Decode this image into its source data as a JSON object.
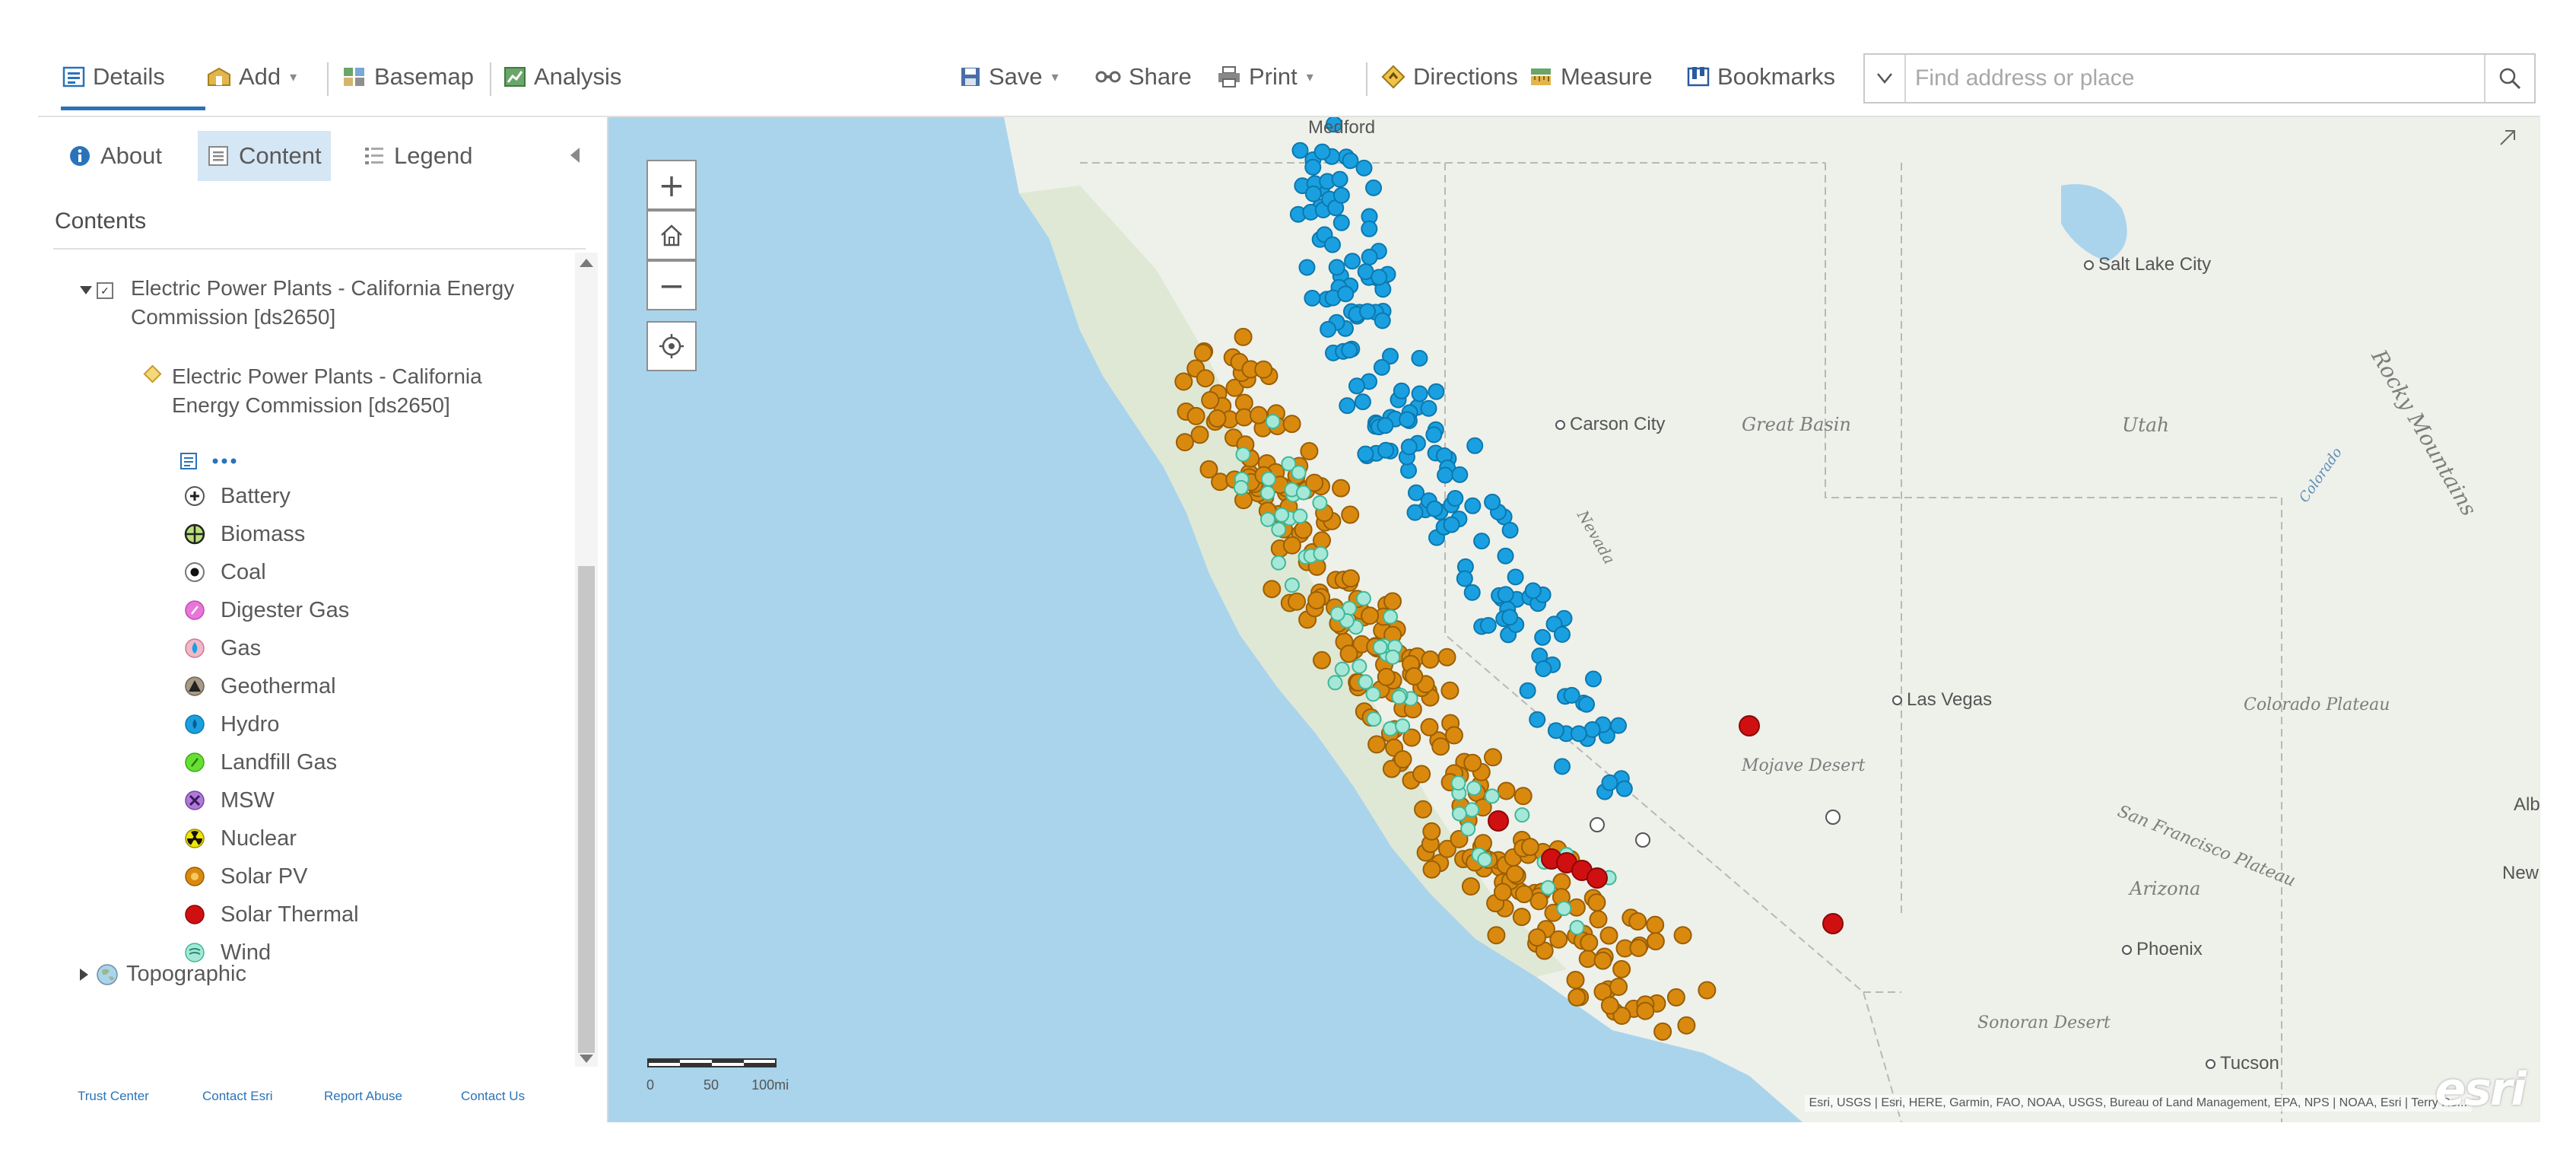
{
  "toolbar": {
    "details": "Details",
    "add": "Add",
    "basemap": "Basemap",
    "analysis": "Analysis",
    "save": "Save",
    "share": "Share",
    "print": "Print",
    "directions": "Directions",
    "measure": "Measure",
    "bookmarks": "Bookmarks",
    "search_placeholder": "Find address or place"
  },
  "panel": {
    "tabs": {
      "about": "About",
      "content": "Content",
      "legend": "Legend"
    },
    "contents_title": "Contents",
    "layer": {
      "title": "Electric Power Plants - California Energy Commission [ds2650]",
      "sublayer_title": "Electric Power Plants - California Energy Commission [ds2650]",
      "legend": [
        {
          "label": "Battery",
          "icon": "battery-icon",
          "color": "#ffffff"
        },
        {
          "label": "Biomass",
          "icon": "biomass-icon",
          "color": "#b8e07a"
        },
        {
          "label": "Coal",
          "icon": "coal-icon",
          "color": "#ffffff"
        },
        {
          "label": "Digester Gas",
          "icon": "digester-gas-icon",
          "color": "#e876d8"
        },
        {
          "label": "Gas",
          "icon": "gas-icon",
          "color": "#f0b8c8"
        },
        {
          "label": "Geothermal",
          "icon": "geothermal-icon",
          "color": "#a89a86"
        },
        {
          "label": "Hydro",
          "icon": "hydro-icon",
          "color": "#1aa0e0"
        },
        {
          "label": "Landfill Gas",
          "icon": "landfill-gas-icon",
          "color": "#66e033"
        },
        {
          "label": "MSW",
          "icon": "msw-icon",
          "color": "#b07ad8"
        },
        {
          "label": "Nuclear",
          "icon": "nuclear-icon",
          "color": "#f2e600"
        },
        {
          "label": "Solar PV",
          "icon": "solar-pv-icon",
          "color": "#d98a0e"
        },
        {
          "label": "Solar Thermal",
          "icon": "solar-thermal-icon",
          "color": "#d01010"
        },
        {
          "label": "Wind",
          "icon": "wind-icon",
          "color": "#a6e8d8"
        }
      ]
    },
    "topographic": "Topographic",
    "footer": {
      "trust_center": "Trust Center",
      "contact_esri": "Contact Esri",
      "report_abuse": "Report Abuse",
      "contact_us": "Contact Us"
    }
  },
  "map": {
    "labels": {
      "salt_lake_city": "Salt Lake City",
      "carson_city": "Carson City",
      "great_basin": "Great Basin",
      "utah": "Utah",
      "rocky_mountains": "Rocky Mountains",
      "nevada": "Nevada",
      "colorado": "Colorado",
      "las_vegas": "Las Vegas",
      "colorado_plateau": "Colorado Plateau",
      "mojave_desert": "Mojave Desert",
      "san_francisco_plateau": "San Francisco Plateau",
      "arizona": "Arizona",
      "phoenix": "Phoenix",
      "sonoran_desert": "Sonoran Desert",
      "tucson": "Tucson",
      "new": "New M",
      "albu": "Albu",
      "medford": "Medford"
    },
    "scale": {
      "zero": "0",
      "fifty": "50",
      "hundred": "100mi"
    },
    "attribution": "Esri, USGS | Esri, HERE, Garmin, FAO, NOAA, USGS, Bureau of Land Management, EPA, NPS | NOAA, Esri | Terry Ro...",
    "logo": "esri",
    "colors": {
      "ocean": "#a9d4ec",
      "land": "#eef0ea",
      "hydro": "#1aa0e0",
      "solar_pv": "#d98a0e",
      "wind": "#a6e8d8",
      "solar_thermal": "#d01010"
    }
  }
}
